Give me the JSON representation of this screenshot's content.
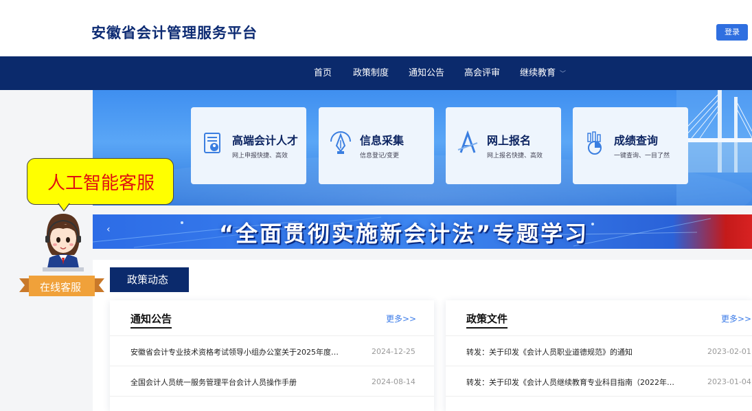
{
  "header": {
    "title": "安徽省会计管理服务平台",
    "login_label": "登录"
  },
  "nav": {
    "items": [
      {
        "label": "首页"
      },
      {
        "label": "政策制度"
      },
      {
        "label": "通知公告"
      },
      {
        "label": "高会评审"
      },
      {
        "label": "继续教育"
      }
    ]
  },
  "features": [
    {
      "title": "高端会计人才",
      "subtitle": "网上申报快捷、高效",
      "icon": "talent-icon"
    },
    {
      "title": "信息采集",
      "subtitle": "信息登记/变更",
      "icon": "collect-icon"
    },
    {
      "title": "网上报名",
      "subtitle": "网上报名快捷、高效",
      "icon": "register-icon"
    },
    {
      "title": "成绩查询",
      "subtitle": "一键查询、一目了然",
      "icon": "score-icon"
    }
  ],
  "slogan": {
    "text": "“全面贯彻实施新会计法”专题学习",
    "prev": "‹"
  },
  "section": {
    "title": "政策动态"
  },
  "notices": {
    "title": "通知公告",
    "more": "更多>>",
    "items": [
      {
        "text": "安徽省会计专业技术资格考试领导小组办公室关于2025年度…",
        "date": "2024-12-25"
      },
      {
        "text": "全国会计人员统一服务管理平台会计人员操作手册",
        "date": "2024-08-14"
      }
    ]
  },
  "policies": {
    "title": "政策文件",
    "more": "更多>>",
    "items": [
      {
        "text": "转发：关于印发《会计人员职业道德规范》的通知",
        "date": "2023-02-01"
      },
      {
        "text": "转发：关于印发《会计人员继续教育专业科目指南（2022年…",
        "date": "2023-01-04"
      }
    ]
  },
  "assistant": {
    "bubble": "人工智能客服",
    "ribbon": "在线客服"
  },
  "colors": {
    "nav": "#0b2a6c",
    "accent": "#2f6fe0",
    "title": "#0d2b73",
    "bubble": "#ffff00",
    "bubble_text": "#e01010"
  }
}
